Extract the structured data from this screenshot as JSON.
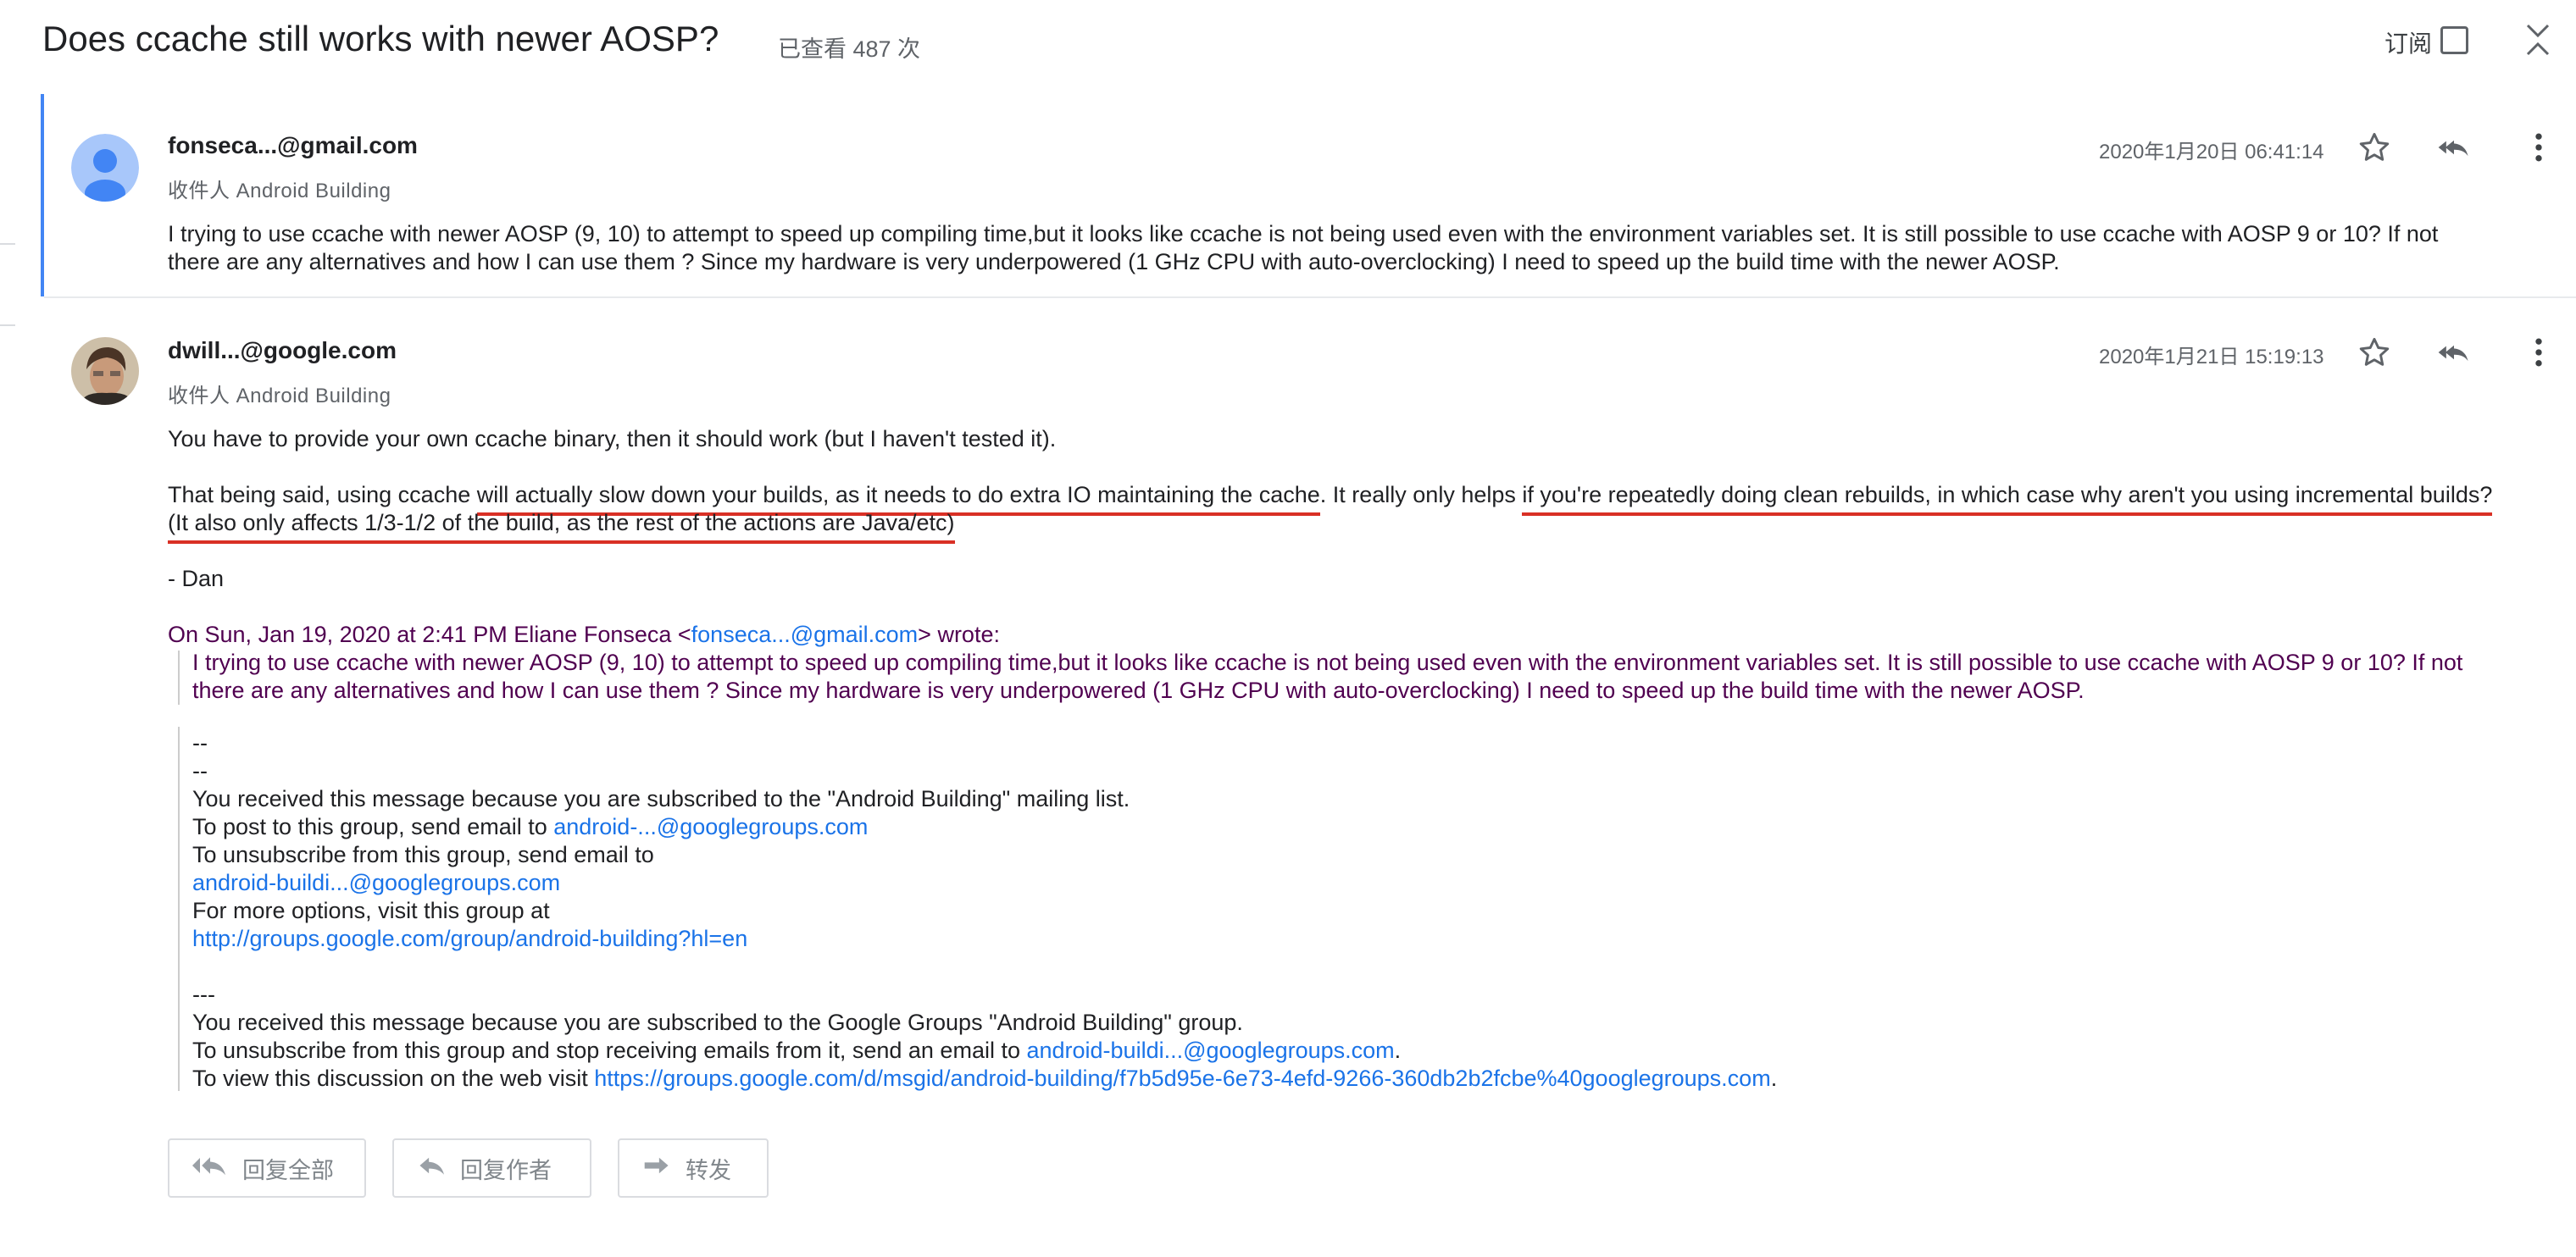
{
  "header": {
    "title": "Does ccache still works with newer AOSP?",
    "view_count": "已查看 487 次",
    "subscribe_label": "订阅"
  },
  "messages": [
    {
      "sender": "fonseca...@gmail.com",
      "recipient": "收件人 Android Building",
      "date": "2020年1月20日 06:41:14",
      "body": [
        "I trying to use ccache with newer AOSP (9, 10) to attempt to speed up compiling time,but it looks like ccache is not being used even with the environment variables set. It is still possible to use ccache with AOSP 9 or 10? If not",
        "there are any alternatives and how I can use them ? Since my hardware is very underpowered (1 GHz CPU with auto-overclocking) I need to speed up the build time with the newer AOSP."
      ]
    },
    {
      "sender": "dwill...@google.com",
      "recipient": "收件人 Android Building",
      "date": "2020年1月21日 15:19:13",
      "p1": "You have to provide your own ccache binary, then it should work (but I haven't tested it).",
      "p2": {
        "a": "That being said, using ccache ",
        "b": "will actually slow down your builds, as it needs to do extra IO maintaining the cache",
        "c": ". It really only helps ",
        "d": "if you're repeatedly doing clean rebuilds, in which case why aren't you using incremental builds?",
        "e": "(It also only affects 1/3-1/2 of the build, as the rest of the actions are Java/etc)"
      },
      "signoff": "- Dan",
      "quote_header": {
        "prefix": "On Sun, Jan 19, 2020 at 2:41 PM Eliane Fonseca <",
        "email": "fonseca...@gmail.com",
        "suffix": "> wrote:"
      },
      "quote_body": [
        "I trying to use ccache with newer AOSP (9, 10) to attempt to speed up compiling time,but it looks like ccache is not being used even with the environment variables set. It is still possible to use ccache with AOSP 9 or 10? If not",
        "there are any alternatives and how I can use them ? Since my hardware is very underpowered (1 GHz CPU with auto-overclocking) I need to speed up the build time with the newer AOSP."
      ],
      "footer": {
        "dash1": "--",
        "dash2": "--",
        "received1": "You received this message because you are subscribed to the \"Android Building\" mailing list.",
        "post_prefix": "To post to this group, send email to ",
        "post_email": "android-...@googlegroups.com",
        "unsub_label": "To unsubscribe from this group, send email to",
        "unsub_email": "android-buildi...@googlegroups.com",
        "more_options": "For more options, visit this group at",
        "group_url": "http://groups.google.com/group/android-building?hl=en",
        "dash3": "---",
        "received2": "You received this message because you are subscribed to the Google Groups \"Android Building\" group.",
        "unsub2_prefix": "To unsubscribe from this group and stop receiving emails from it, send an email to ",
        "unsub2_email": "android-buildi...@googlegroups.com",
        "unsub2_suffix": ".",
        "view_prefix": "To view this discussion on the web visit ",
        "view_url": "https://groups.google.com/d/msgid/android-building/f7b5d95e-6e73-4efd-9266-360db2b2fcbe%40googlegroups.com",
        "view_suffix": "."
      }
    }
  ],
  "actions": {
    "reply_all": "回复全部",
    "reply_author": "回复作者",
    "forward": "转发"
  },
  "colors": {
    "accent": "#4285f4",
    "link": "#1a73e8",
    "quote_text": "#500050",
    "underline": "#d93025"
  }
}
